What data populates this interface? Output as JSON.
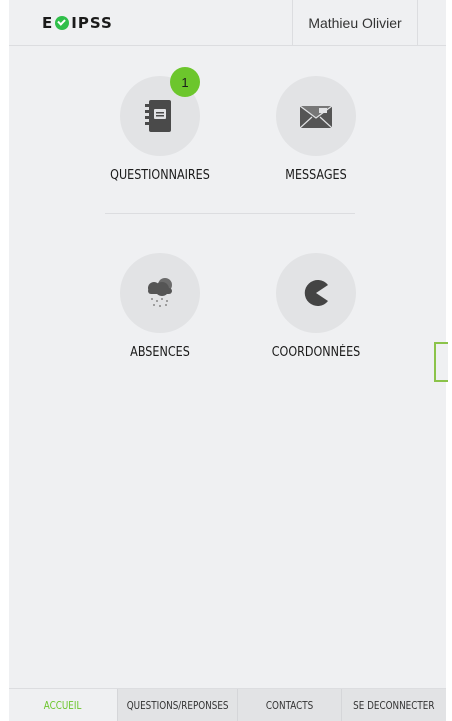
{
  "header": {
    "brand": {
      "before": "E",
      "after": "IPSS"
    },
    "user_name": "Mathieu Olivier"
  },
  "tiles": {
    "questionnaires": {
      "label": "QUESTIONNAIRES",
      "icon": "notebook-icon",
      "badge": "1"
    },
    "messages": {
      "label": "MESSAGES",
      "icon": "envelope-icon"
    },
    "absences": {
      "label": "ABSENCES",
      "icon": "cloud-snow-icon"
    },
    "coordonnees": {
      "label": "COORDONNÉES",
      "icon": "pacman-icon"
    }
  },
  "footer": {
    "tabs": [
      {
        "label": "ACCUEIL",
        "active": true
      },
      {
        "label": "QUESTIONS/REPONSES",
        "active": false
      },
      {
        "label": "CONTACTS",
        "active": false
      },
      {
        "label": "SE DECONNECTER",
        "active": false
      }
    ]
  },
  "colors": {
    "accent": "#6cc62c",
    "background": "#eff0f2",
    "tile_circle": "#e2e3e5",
    "arrow_border": "#8bc34a"
  }
}
